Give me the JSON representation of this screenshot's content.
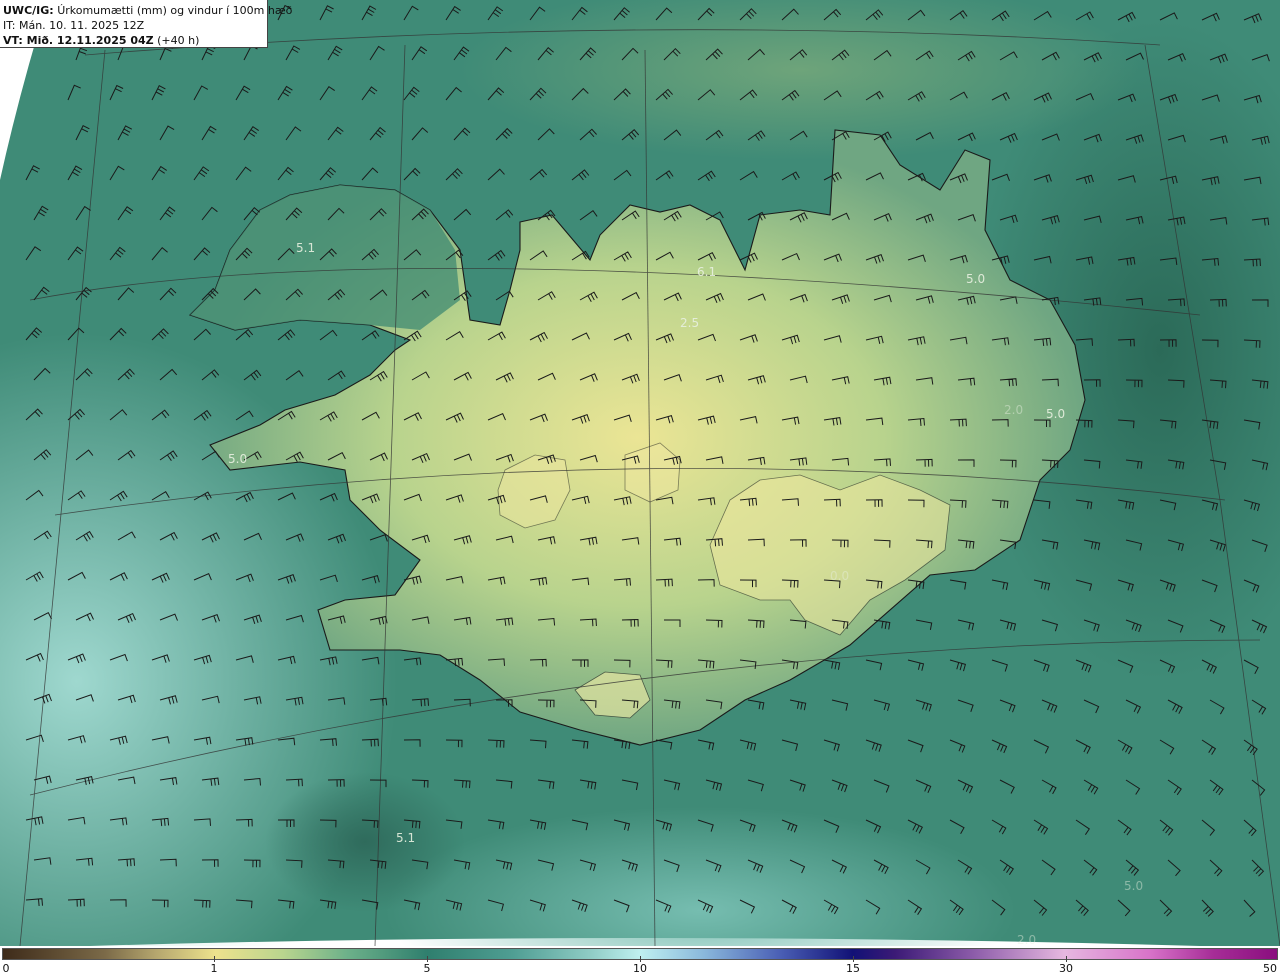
{
  "header": {
    "product": "UWC/IG:",
    "title": "Úrkomumætti (mm) og vindur í 100m hæð",
    "init_time": "IT: Mán. 10. 11. 2025 12Z",
    "valid_prefix": "VT: Mið. 12.11.2025 04Z",
    "valid_suffix": "(+40 h)"
  },
  "colorbar": {
    "ticks": [
      "0",
      "1",
      "5",
      "10",
      "15",
      "30",
      "50"
    ]
  },
  "value_labels": [
    {
      "text": "5.1"
    },
    {
      "text": "6.1"
    },
    {
      "text": "2.5"
    },
    {
      "text": "5.0"
    },
    {
      "text": "5.0"
    },
    {
      "text": "5.0"
    },
    {
      "text": "5.1"
    },
    {
      "text": "0.0"
    },
    {
      "text": "5.0"
    },
    {
      "text": "2.0"
    },
    {
      "text": "2.0"
    }
  ],
  "colors": {
    "sea_base": "#3d8a78",
    "sea_light": "#8fd0c8",
    "land_high": "#e6e08c",
    "land_mid": "#7fb080",
    "coast": "#1a1a1a",
    "grid": "#333333"
  }
}
